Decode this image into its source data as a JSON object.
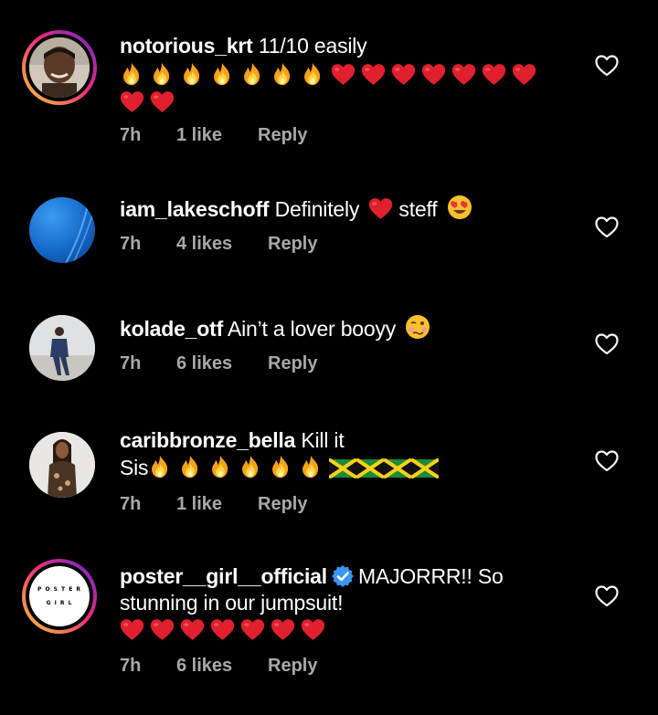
{
  "colors": {
    "background": "#000000",
    "text": "#ffffff",
    "meta": "#a8a8a8",
    "verified": "#3897f0"
  },
  "comments": [
    {
      "username": "notorious_krt",
      "text": "11/10 easily",
      "emoji_line": "🔥🔥🔥🔥🔥🔥🔥❤️❤️❤️❤️❤️❤️❤️❤️❤️",
      "time": "7h",
      "likes": "1 like",
      "reply": "Reply",
      "story_ring": true
    },
    {
      "username": "iam_lakeschoff",
      "text_before": "Definitely",
      "text_after": "steff",
      "emojis": "❤️ 😍",
      "time": "7h",
      "likes": "4 likes",
      "reply": "Reply",
      "story_ring": false
    },
    {
      "username": "kolade_otf",
      "text": "Ain’t a lover booyy",
      "emojis": "🥴",
      "time": "7h",
      "likes": "6 likes",
      "reply": "Reply",
      "story_ring": false
    },
    {
      "username": "caribbronze_bella",
      "text": "Kill it",
      "text_line2": "Sis",
      "emoji_line": "🔥🔥🔥🔥🔥🔥🇯🇲🇯🇲🇯🇲🇯🇲",
      "time": "7h",
      "likes": "1 like",
      "reply": "Reply",
      "story_ring": false
    },
    {
      "username": "poster__girl__official",
      "verified": true,
      "text": "MAJORRR!! So",
      "text_line2": "stunning in our jumpsuit!",
      "emoji_line": "❤️❤️❤️❤️❤️❤️❤️",
      "avatar_text_top": "P O S T E R",
      "avatar_text_bottom": "G I R L",
      "time": "7h",
      "likes": "6 likes",
      "reply": "Reply",
      "story_ring": true
    }
  ]
}
